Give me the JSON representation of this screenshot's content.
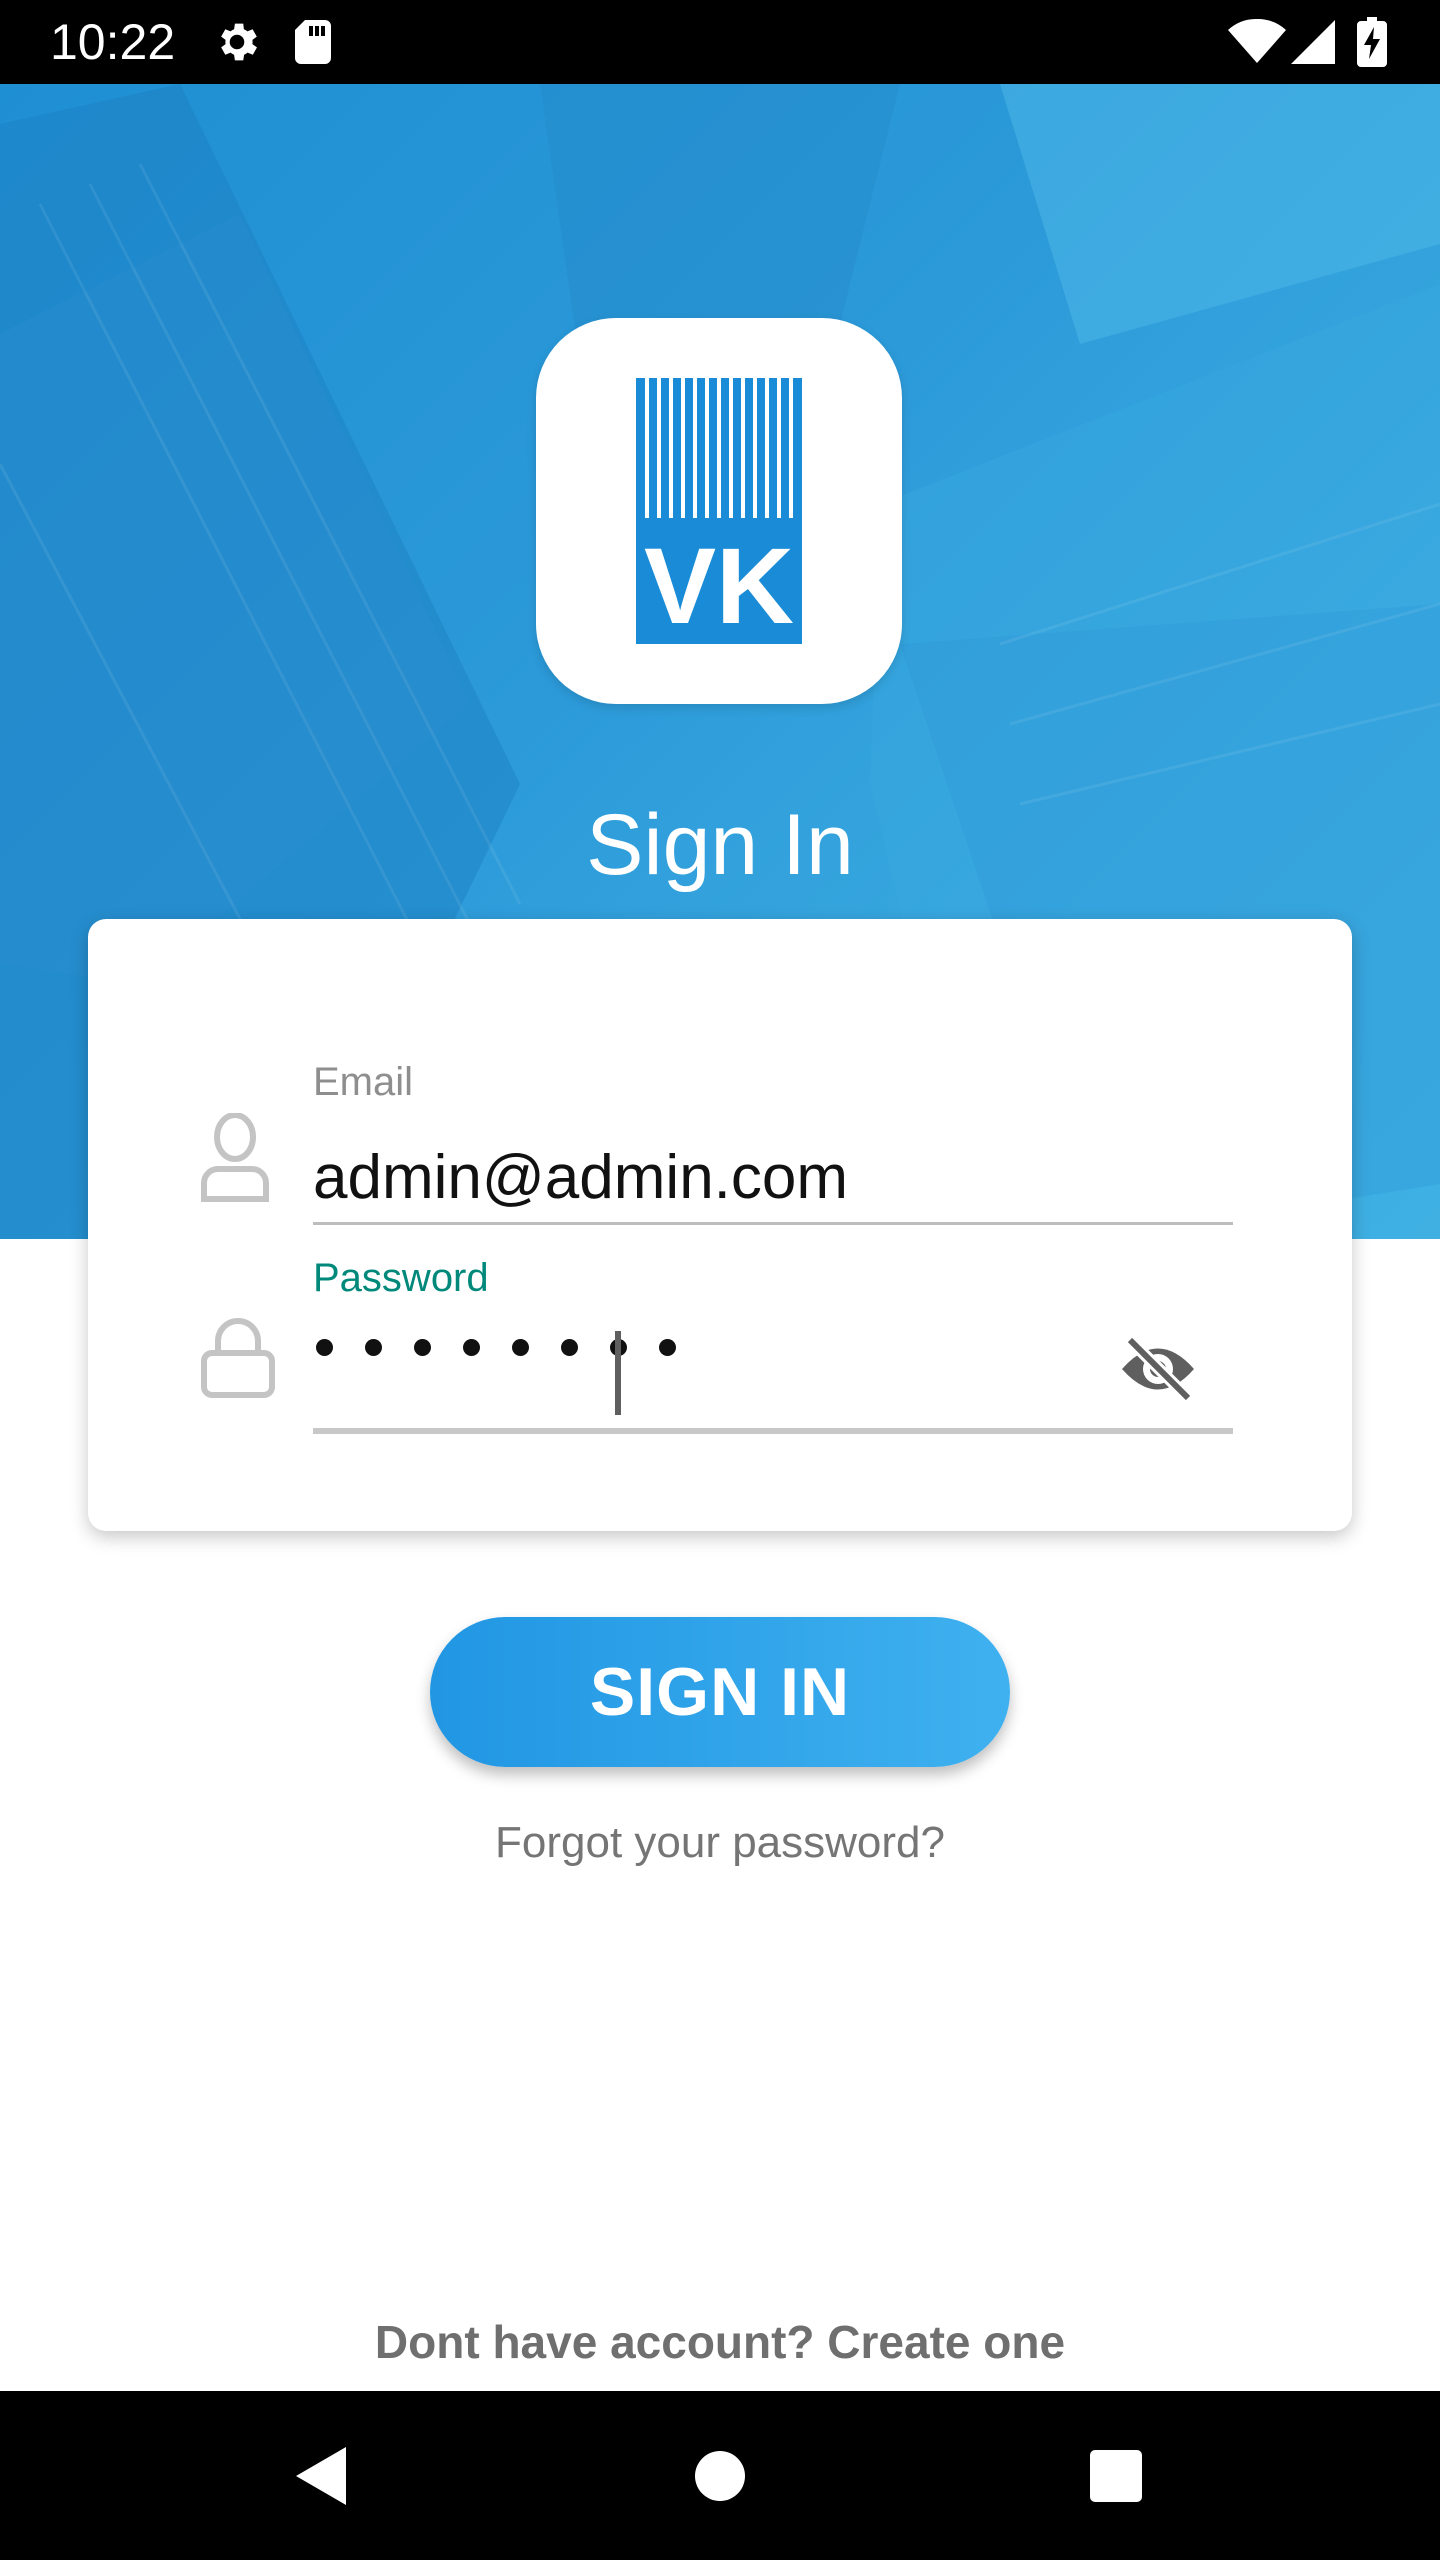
{
  "status_bar": {
    "time": "10:22",
    "left_icons": [
      "settings-icon",
      "sd-card-icon"
    ],
    "right_icons": [
      "wifi-icon",
      "cell-signal-icon",
      "battery-charging-icon"
    ]
  },
  "hero": {
    "logo_text": "VK",
    "title": "Sign In",
    "colors": {
      "gradient_start": "#1f8fd3",
      "gradient_end": "#45b7e6"
    }
  },
  "form": {
    "email": {
      "label": "Email",
      "value": "admin@admin.com",
      "icon": "person-icon"
    },
    "password": {
      "label": "Password",
      "masked_value": "••••••••",
      "icon": "lock-icon",
      "toggle_icon": "eye-off-icon",
      "label_color": "#00897b"
    }
  },
  "actions": {
    "sign_in_label": "SIGN IN",
    "forgot_password": "Forgot your password?",
    "create_account": "Dont have account? Create one"
  },
  "nav_bar": {
    "buttons": [
      "back-icon",
      "home-icon",
      "recents-icon"
    ]
  }
}
